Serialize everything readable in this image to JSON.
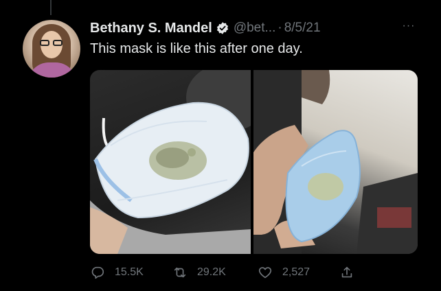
{
  "tweet": {
    "author_name": "Bethany S. Mandel",
    "handle": "@bet...",
    "separator": "·",
    "date": "8/5/21",
    "more": "···",
    "text": "This mask is like this after one day."
  },
  "actions": {
    "replies": "15.5K",
    "retweets": "29.2K",
    "likes": "2,527"
  },
  "icons": {
    "verified": "verified-badge-icon",
    "reply": "reply-icon",
    "retweet": "retweet-icon",
    "like": "heart-icon",
    "share": "share-icon",
    "more": "more-icon"
  }
}
